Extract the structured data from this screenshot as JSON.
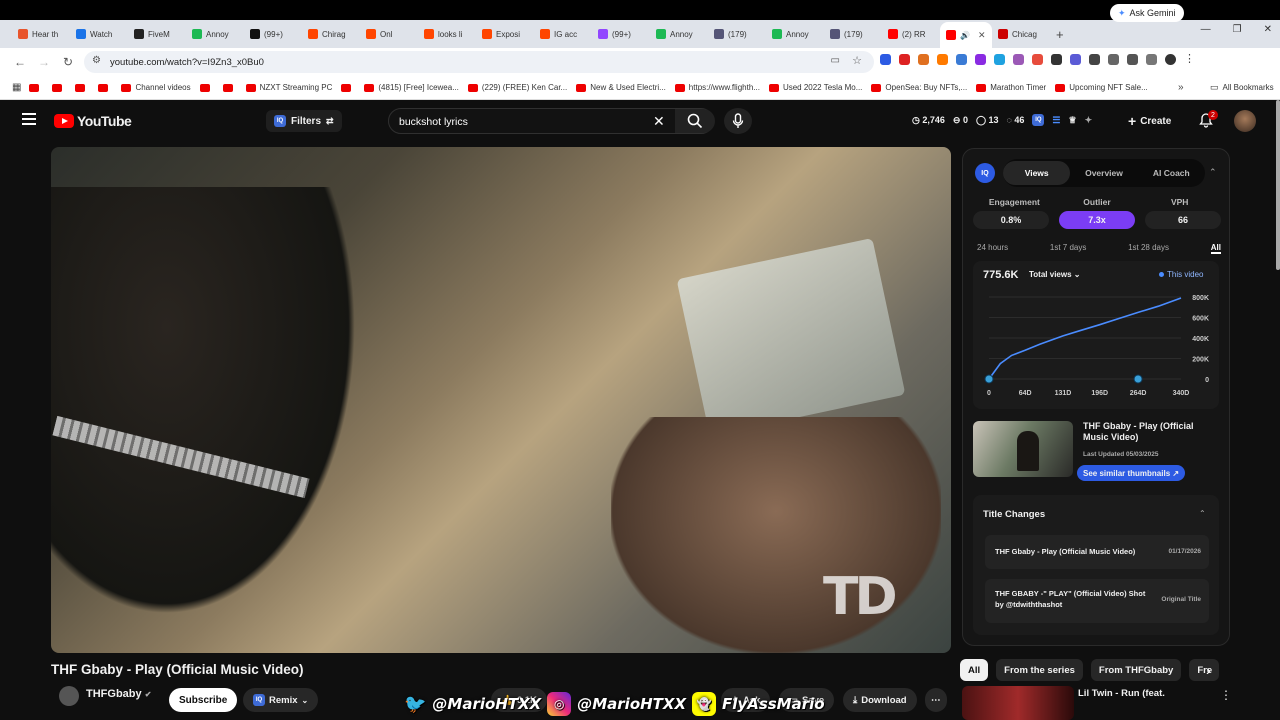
{
  "browser": {
    "tabs": [
      {
        "label": "Hear th",
        "color": "#e8542b"
      },
      {
        "label": "Watch",
        "color": "#1a73e8"
      },
      {
        "label": "FiveM",
        "color": "#222222"
      },
      {
        "label": "Annoy",
        "color": "#1db954"
      },
      {
        "label": "(99+)",
        "color": "#111111"
      },
      {
        "label": "Chirag",
        "color": "#ff4500"
      },
      {
        "label": "Onl",
        "color": "#ff4500"
      },
      {
        "label": "looks li",
        "color": "#ff4500"
      },
      {
        "label": "Exposi",
        "color": "#ff4500"
      },
      {
        "label": "IG acc",
        "color": "#ff4500"
      },
      {
        "label": "(99+)",
        "color": "#9146ff"
      },
      {
        "label": "Annoy",
        "color": "#1db954"
      },
      {
        "label": "(179)",
        "color": "#555577"
      },
      {
        "label": "Annoy",
        "color": "#1db954"
      },
      {
        "label": "(179)",
        "color": "#555577"
      },
      {
        "label": "(2) RR",
        "color": "#ff0000"
      },
      {
        "label": "",
        "color": "#ff0000",
        "active": true
      },
      {
        "label": "Chicag",
        "color": "#cc0000"
      }
    ],
    "ask_gemini": "Ask Gemini",
    "url": "youtube.com/watch?v=I9Zn3_x0Bu0",
    "bookmarks": [
      {
        "label": ""
      },
      {
        "label": ""
      },
      {
        "label": ""
      },
      {
        "label": ""
      },
      {
        "label": "Channel videos"
      },
      {
        "label": ""
      },
      {
        "label": ""
      },
      {
        "label": "NZXT Streaming PC"
      },
      {
        "label": ""
      },
      {
        "label": "(4815) [Free] Icewea..."
      },
      {
        "label": "(229) (FREE) Ken Car..."
      },
      {
        "label": "New & Used Electri..."
      },
      {
        "label": "https://www.flighth..."
      },
      {
        "label": "Used 2022 Tesla Mo..."
      },
      {
        "label": "OpenSea: Buy NFTs,..."
      },
      {
        "label": "Marathon Timer"
      },
      {
        "label": "Upcoming NFT Sale..."
      }
    ],
    "all_bookmarks": "All Bookmarks"
  },
  "youtube": {
    "logo": "YouTube",
    "filters": "Filters",
    "search_value": "buckshot lyrics",
    "stats": [
      "2,746",
      "0",
      "13",
      "46"
    ],
    "create": "Create",
    "notifications": "2"
  },
  "video": {
    "watermark": "TD",
    "title": "THF Gbaby - Play (Official Music Video)",
    "channel": "THFGbaby",
    "subscribe": "Subscribe",
    "remix": "Remix",
    "likes": "6.1K",
    "ask": "Ask",
    "save": "Save",
    "download": "Download"
  },
  "overlay": {
    "twitter": "@MarioHTXX",
    "instagram": "@MarioHTXX",
    "snapchat": "FlyAssMario"
  },
  "vidiq": {
    "logo": "IQ",
    "tabs": [
      "Views",
      "Overview",
      "AI Coach"
    ],
    "metric_labels": [
      "Engagement",
      "Outlier",
      "VPH"
    ],
    "metric_values": [
      "0.8%",
      "7.3x",
      "66"
    ],
    "ranges": [
      "24 hours",
      "1st 7 days",
      "1st 28 days",
      "All"
    ],
    "total": "775.6K",
    "metric": "Total views",
    "legend": "This video",
    "thumb_title": "THF Gbaby - Play (Official Music Video)",
    "last_updated": "Last Updated 05/03/2025",
    "similar": "See similar thumbnails",
    "title_changes_label": "Title Changes",
    "title_changes": [
      {
        "title": "THF Gbaby - Play (Official Music Video)",
        "date": "01/17/2026"
      },
      {
        "title": "THF GBABY -\" PLAY\" (Official Video) Shot by @tdwiththashot",
        "date": "Original Title"
      }
    ]
  },
  "chart_data": {
    "type": "line",
    "x": [
      0,
      20,
      40,
      64,
      90,
      131,
      160,
      196,
      230,
      264,
      300,
      340
    ],
    "values": [
      0,
      150,
      230,
      280,
      340,
      420,
      470,
      530,
      590,
      650,
      710,
      790
    ],
    "xticks": [
      "0",
      "64D",
      "131D",
      "196D",
      "264D",
      "340D"
    ],
    "yticks": [
      "800K",
      "600K",
      "400K",
      "200K",
      "0"
    ],
    "xlim": [
      0,
      340
    ],
    "ylim": [
      0,
      800
    ],
    "markers_x": [
      0,
      264
    ],
    "color": "#4a8cff"
  },
  "chips": [
    "All",
    "From the series",
    "From THFGbaby",
    "Fre"
  ],
  "recommendation": {
    "title": "Lil Twin - Run (feat."
  }
}
